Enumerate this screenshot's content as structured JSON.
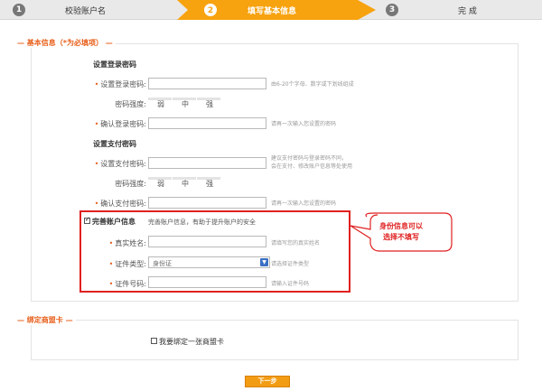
{
  "steps": [
    {
      "num": "1",
      "label": "校验账户名"
    },
    {
      "num": "2",
      "label": "填写基本信息"
    },
    {
      "num": "3",
      "label": "完 成"
    }
  ],
  "basic": {
    "legend": "基本信息（*为必填项）",
    "login_section": "设置登录密码",
    "login_password_label": "设置登录密码:",
    "login_password_hint": "由6-20个字母、数字或下划线组成",
    "strength_label": "密码强度:",
    "strength_levels": [
      "弱",
      "中",
      "强"
    ],
    "confirm_login_label": "确认登录密码:",
    "confirm_login_hint": "请再一次输入您设置的密码",
    "pay_section": "设置支付密码",
    "pay_password_label": "设置支付密码:",
    "pay_password_hint_1": "建议支付密码与登录密码不同，",
    "pay_password_hint_2": "会在支付、修改账户信息等处使用",
    "confirm_pay_label": "确认支付密码:",
    "confirm_pay_hint": "请再一次输入您设置的密码"
  },
  "account_info": {
    "checkbox_label": "完善账户信息",
    "checked": true,
    "desc": "完善账户信息，有助于提升账户的安全",
    "real_name_label": "真实姓名:",
    "real_name_hint": "请填写您的真实姓名",
    "id_type_label": "证件类型:",
    "id_type_value": "身份证",
    "id_type_hint": "请选择证件类型",
    "id_number_label": "证件号码:",
    "id_number_hint": "请输入证件号码"
  },
  "callout": {
    "line1": "身份信息可以",
    "line2": "选择不填写",
    "color": "#e02020"
  },
  "bind_card": {
    "legend": "绑定商盟卡",
    "checkbox_label": "我要绑定一张商盟卡",
    "checked": false
  },
  "next_button": "下一步",
  "colors": {
    "accent": "#f7a20f",
    "legend": "#e8601c",
    "required": "#e8601c",
    "annotation": "#e02020"
  }
}
